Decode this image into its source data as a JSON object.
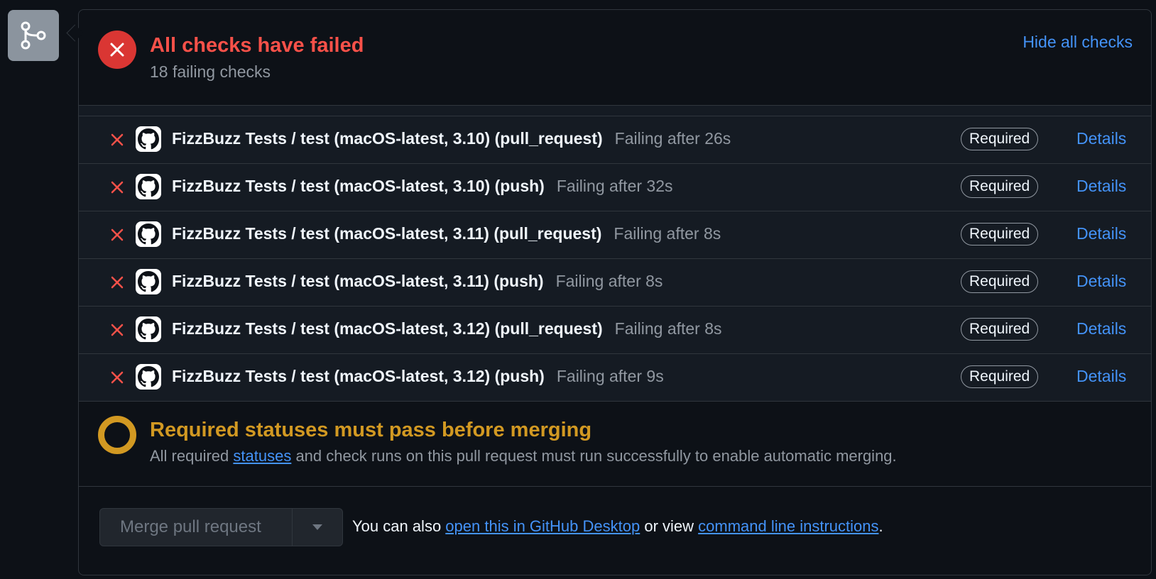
{
  "header": {
    "title": "All checks have failed",
    "subtitle": "18 failing checks",
    "toggle_label": "Hide all checks"
  },
  "checks": [
    {
      "name": "FizzBuzz Tests / test (macOS-latest, 3.10) (pull_request)",
      "status": "Failing after 26s",
      "badge": "Required",
      "link": "Details"
    },
    {
      "name": "FizzBuzz Tests / test (macOS-latest, 3.10) (push)",
      "status": "Failing after 32s",
      "badge": "Required",
      "link": "Details"
    },
    {
      "name": "FizzBuzz Tests / test (macOS-latest, 3.11) (pull_request)",
      "status": "Failing after 8s",
      "badge": "Required",
      "link": "Details"
    },
    {
      "name": "FizzBuzz Tests / test (macOS-latest, 3.11) (push)",
      "status": "Failing after 8s",
      "badge": "Required",
      "link": "Details"
    },
    {
      "name": "FizzBuzz Tests / test (macOS-latest, 3.12) (pull_request)",
      "status": "Failing after 8s",
      "badge": "Required",
      "link": "Details"
    },
    {
      "name": "FizzBuzz Tests / test (macOS-latest, 3.12) (push)",
      "status": "Failing after 9s",
      "badge": "Required",
      "link": "Details"
    }
  ],
  "required": {
    "title": "Required statuses must pass before merging",
    "desc_prefix": "All required ",
    "desc_link": "statuses",
    "desc_suffix": " and check runs on this pull request must run successfully to enable automatic merging."
  },
  "merge": {
    "button_label": "Merge pull request",
    "note_prefix": "You can also ",
    "desktop_link": "open this in GitHub Desktop",
    "note_middle": " or view ",
    "cli_link": "command line instructions",
    "note_suffix": "."
  },
  "colors": {
    "failure": "#f85149",
    "pending": "#d29922",
    "link": "#4493f8",
    "background": "#0d1117"
  },
  "icons": {
    "side_badge": "git-merge-icon",
    "header_status": "x-circle-icon",
    "row_status": "x-icon",
    "row_avatar": "github-mark-icon",
    "pending_status": "pending-dot-icon",
    "merge_dropdown": "triangle-down-icon"
  }
}
